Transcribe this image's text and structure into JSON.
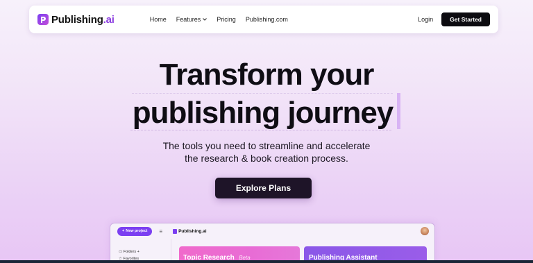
{
  "nav": {
    "logo_main": "Publishing",
    "logo_accent": ".ai",
    "links": [
      "Home",
      "Features",
      "Pricing",
      "Publishing.com"
    ],
    "login": "Login",
    "cta": "Get Started"
  },
  "hero": {
    "line1": "Transform your",
    "line2": "publishing journey",
    "subtitle_line1": "The tools you need to streamline and accelerate",
    "subtitle_line2": "the research & book creation process.",
    "cta": "Explore Plans"
  },
  "preview": {
    "new_project": "New project",
    "menu_icon": "≡",
    "logo": "Publishing.ai",
    "sidebar": [
      "Folders",
      "Favorites"
    ],
    "cards": [
      {
        "title": "Topic Research",
        "badge": "Beta"
      },
      {
        "title": "Publishing Assistant",
        "badge": ""
      }
    ]
  },
  "colors": {
    "brand": "#7b3ff1",
    "cta_dark": "#0c0b10",
    "card_pink": "#f06acb",
    "card_purple": "#8a57e8"
  }
}
